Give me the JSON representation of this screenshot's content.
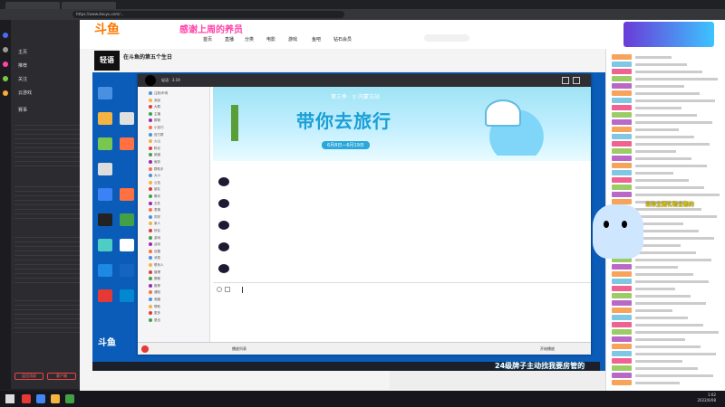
{
  "browser": {
    "address": "https://www.douyu.com/..."
  },
  "site": {
    "logo": "斗鱼",
    "banner_text": "感谢上周的养员",
    "nav": [
      "首页",
      "直播",
      "分类",
      "电影",
      "游戏",
      "鱼吧",
      "钻石会员"
    ]
  },
  "sidebar": {
    "items": [
      "主页",
      "推荐",
      "关注",
      "云游戏",
      "赛事"
    ],
    "bottom_buttons": [
      "返回顶部",
      "客户端"
    ]
  },
  "room": {
    "title": "在斗鱼的第五个生日",
    "streamer_logo": "轻语"
  },
  "qq": {
    "title": "轻语 · 3.19",
    "banner_season": "第三季 · ♀ 内蒙古站",
    "banner_main": "带你去旅行",
    "banner_date": "6月8日—6月19日",
    "list_items": [
      "注册/申请",
      "添加",
      "大群",
      "主播",
      "群聊",
      "小技巧",
      "官方群",
      "火山",
      "粉丝",
      "频道",
      "鱼跃",
      "群助手",
      "大小",
      "公告",
      "朋友",
      "聊天",
      "文件",
      "表情",
      "同学",
      "家人",
      "好友",
      "游戏",
      "活动",
      "设置",
      "消息",
      "联系人",
      "管理",
      "屏蔽",
      "推荐",
      "通知",
      "收藏",
      "帮助",
      "更多",
      "退出"
    ],
    "bottom_label": "播放列表",
    "bottom_right": "开始播放"
  },
  "overlay": {
    "text1": "当你主播礼物全都的",
    "text2": "24级牌子主动找我要房管的"
  },
  "taskbar": {
    "time": "1:02",
    "date": "2022/6/08"
  },
  "colors": {
    "accent": "#ff7700",
    "qq_blue": "#1a9fd6",
    "desktop": "#0a5cb8"
  }
}
